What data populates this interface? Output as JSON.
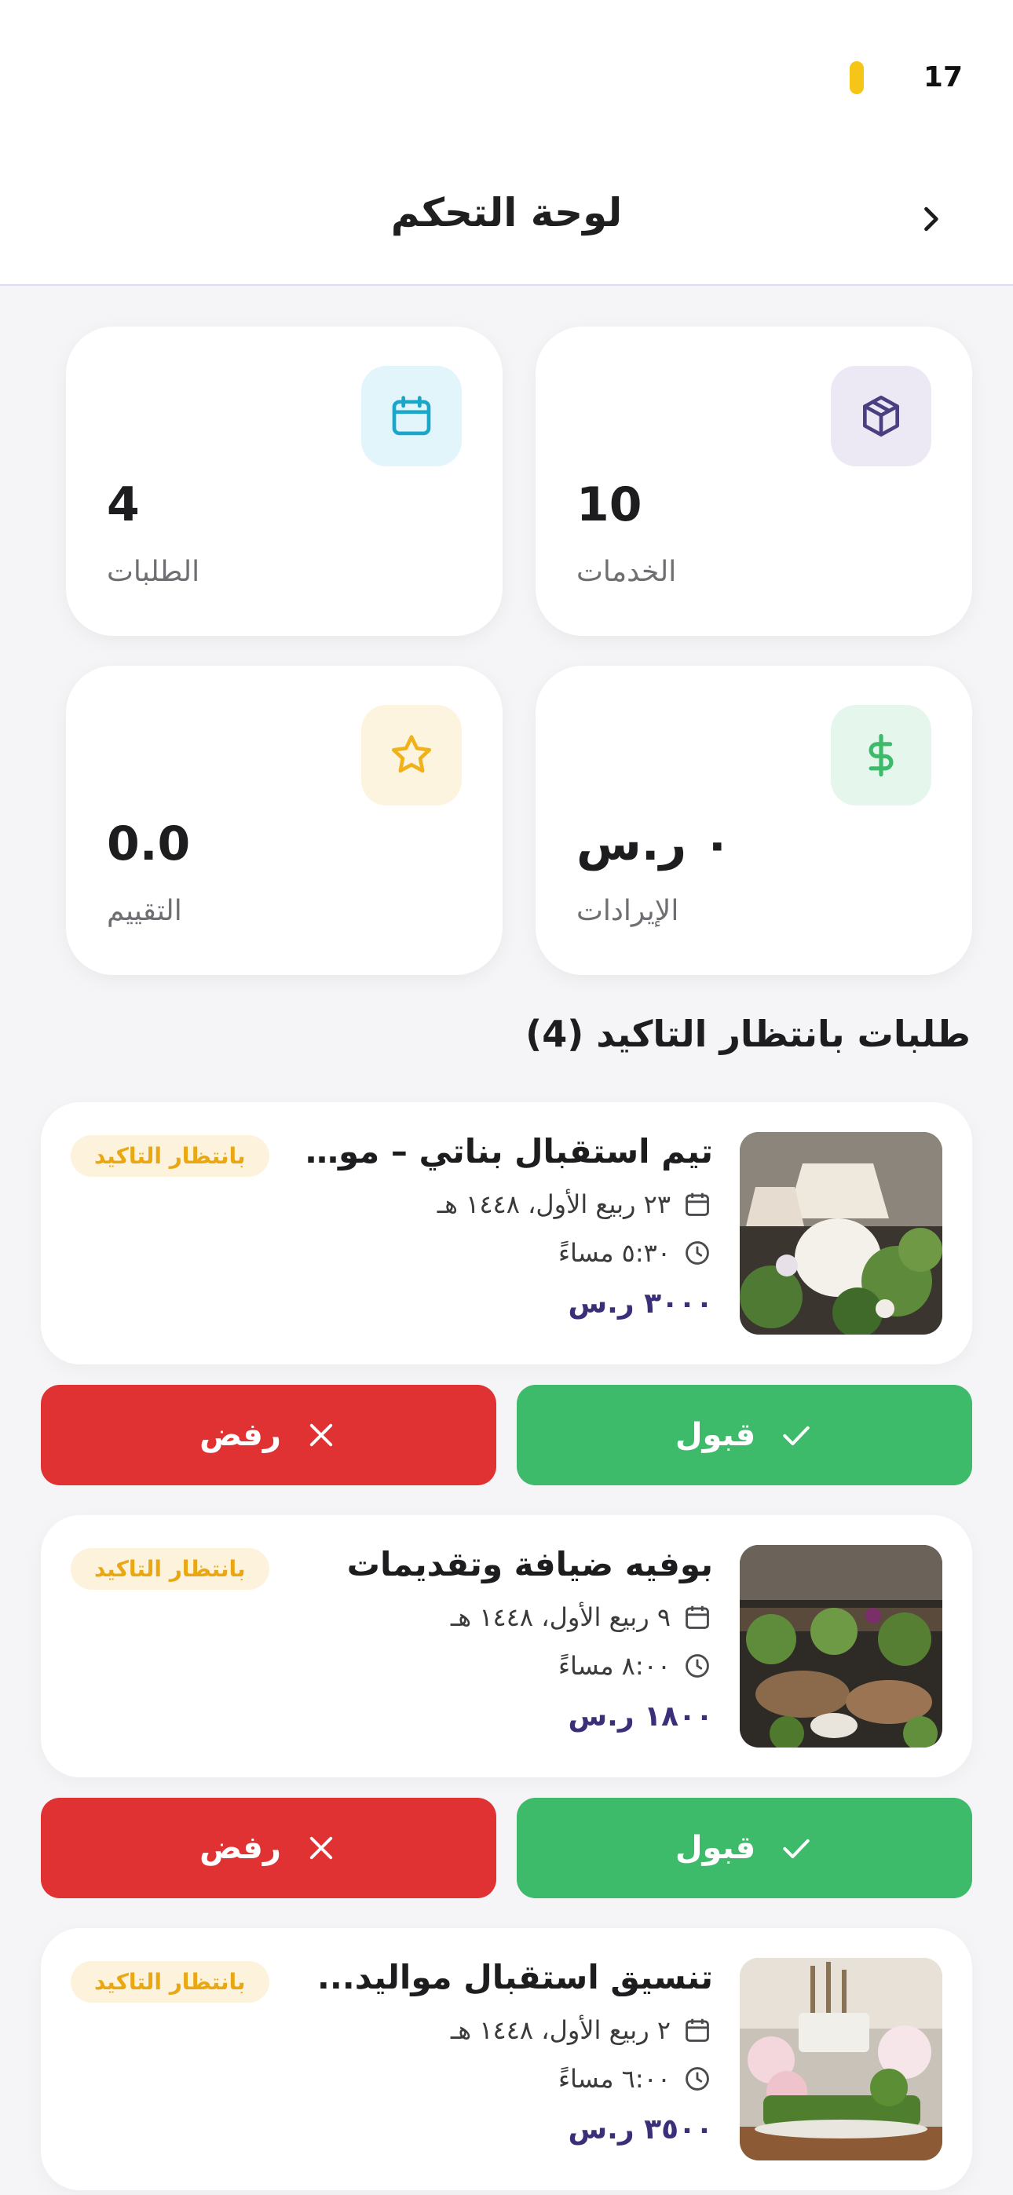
{
  "status": {
    "time": "17"
  },
  "header": {
    "title": "لوحة التحكم"
  },
  "stats": [
    {
      "label": "الخدمات",
      "value": "10",
      "icon": "box-icon",
      "icon_bg": "#ece9f5",
      "icon_color": "#4a3f80"
    },
    {
      "label": "الطلبات",
      "value": "4",
      "icon": "calendar-icon",
      "icon_bg": "#e2f5fb",
      "icon_color": "#1aa6c8"
    },
    {
      "label": "الإيرادات",
      "value": "٠ ر.س",
      "icon": "dollar-icon",
      "icon_bg": "#e5f6ec",
      "icon_color": "#3dba6a"
    },
    {
      "label": "التقييم",
      "value": "0.0",
      "icon": "star-icon",
      "icon_bg": "#fdf4e0",
      "icon_color": "#f0b21a"
    }
  ],
  "section": {
    "title": "طلبات بانتظار التاكيد (4)"
  },
  "orders": [
    {
      "name": "تيم استقبال بناتي – مو...",
      "badge": "بانتظار التاكيد",
      "date": "٢٣ ربيع الأول، ١٤٤٨ هـ",
      "time": "٥:٣٠ مساءً",
      "price": "٣٠٠٠ ر.س"
    },
    {
      "name": "بوفيه ضيافة وتقديمات",
      "badge": "بانتظار التاكيد",
      "date": "٩ ربيع الأول، ١٤٤٨ هـ",
      "time": "٨:٠٠ مساءً",
      "price": "١٨٠٠ ر.س"
    },
    {
      "name": "تنسيق استقبال مواليد...",
      "badge": "بانتظار التاكيد",
      "date": "٢ ربيع الأول، ١٤٤٨ هـ",
      "time": "٦:٠٠ مساءً",
      "price": "٣٥٠٠ ر.س"
    }
  ],
  "actions": {
    "accept": "قبول",
    "reject": "رفض"
  },
  "colors": {
    "accept": "#3dba6a",
    "reject": "#e03232",
    "badge": "#e9a712",
    "price": "#3b2f7a"
  }
}
